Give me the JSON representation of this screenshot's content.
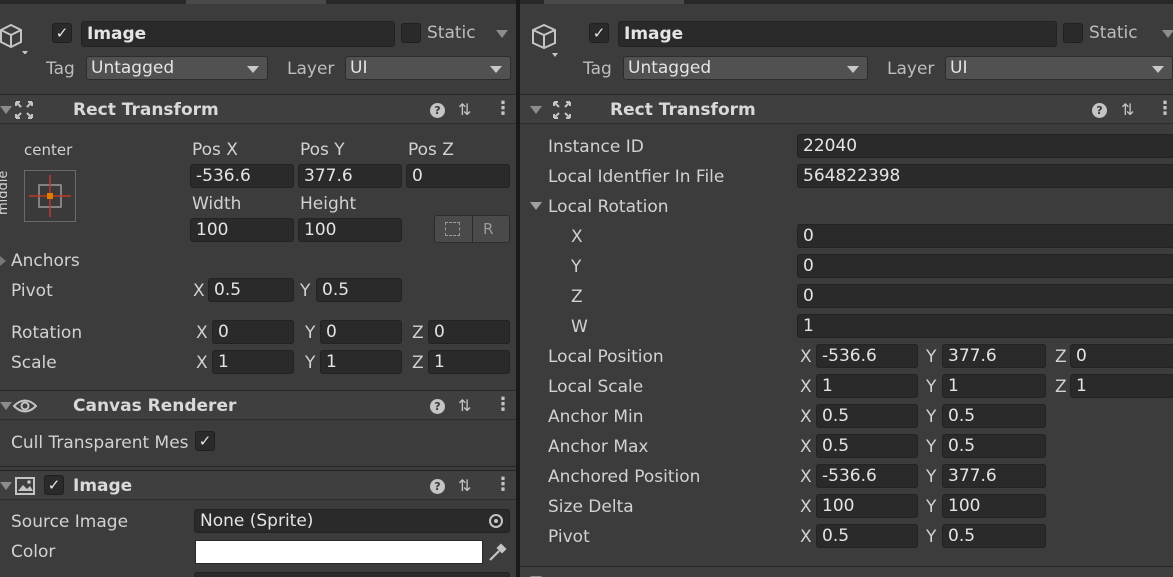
{
  "left": {
    "object_name": "Image",
    "static_label": "Static",
    "tag_label": "Tag",
    "tag_value": "Untagged",
    "layer_label": "Layer",
    "layer_value": "UI",
    "rect_transform": {
      "title": "Rect Transform",
      "anchor_h": "center",
      "anchor_v": "middle",
      "pos_x_label": "Pos X",
      "pos_y_label": "Pos Y",
      "pos_z_label": "Pos Z",
      "pos_x": "-536.6",
      "pos_y": "377.6",
      "pos_z": "0",
      "width_label": "Width",
      "height_label": "Height",
      "width": "100",
      "height": "100",
      "raw_button": "R",
      "anchors_label": "Anchors",
      "pivot_label": "Pivot",
      "pivot_x": "0.5",
      "pivot_y": "0.5",
      "rotation_label": "Rotation",
      "rot_x": "0",
      "rot_y": "0",
      "rot_z": "0",
      "scale_label": "Scale",
      "scale_x": "1",
      "scale_y": "1",
      "scale_z": "1",
      "x": "X",
      "y": "Y",
      "z": "Z"
    },
    "canvas_renderer": {
      "title": "Canvas Renderer",
      "cull_label": "Cull Transparent Mes"
    },
    "image": {
      "title": "Image",
      "source_image_label": "Source Image",
      "source_image_value": "None (Sprite)",
      "color_label": "Color",
      "color_value": "#ffffff"
    }
  },
  "right": {
    "object_name": "Image",
    "static_label": "Static",
    "tag_label": "Tag",
    "tag_value": "Untagged",
    "layer_label": "Layer",
    "layer_value": "UI",
    "rect_transform": {
      "title": "Rect Transform",
      "instance_id_label": "Instance ID",
      "instance_id": "22040",
      "local_id_label": "Local Identfier In File",
      "local_id": "564822398",
      "local_rotation_label": "Local Rotation",
      "rot_x_label": "X",
      "rot_x": "0",
      "rot_y_label": "Y",
      "rot_y": "0",
      "rot_z_label": "Z",
      "rot_z": "0",
      "rot_w_label": "W",
      "rot_w": "1",
      "local_position_label": "Local Position",
      "lp_x": "-536.6",
      "lp_y": "377.6",
      "lp_z": "0",
      "local_scale_label": "Local Scale",
      "ls_x": "1",
      "ls_y": "1",
      "ls_z": "1",
      "anchor_min_label": "Anchor Min",
      "amin_x": "0.5",
      "amin_y": "0.5",
      "anchor_max_label": "Anchor Max",
      "amax_x": "0.5",
      "amax_y": "0.5",
      "anchored_position_label": "Anchored Position",
      "ap_x": "-536.6",
      "ap_y": "377.6",
      "size_delta_label": "Size Delta",
      "sd_x": "100",
      "sd_y": "100",
      "pivot_label": "Pivot",
      "pv_x": "0.5",
      "pv_y": "0.5",
      "x": "X",
      "y": "Y",
      "z": "Z"
    }
  },
  "icons": {
    "checkmark": "✓",
    "help": "?"
  },
  "colors": {
    "panel_bg": "#3c3c3c",
    "field_bg": "#2a2a2a",
    "divider": "#191919",
    "anchor_accent": "#e07a00"
  }
}
